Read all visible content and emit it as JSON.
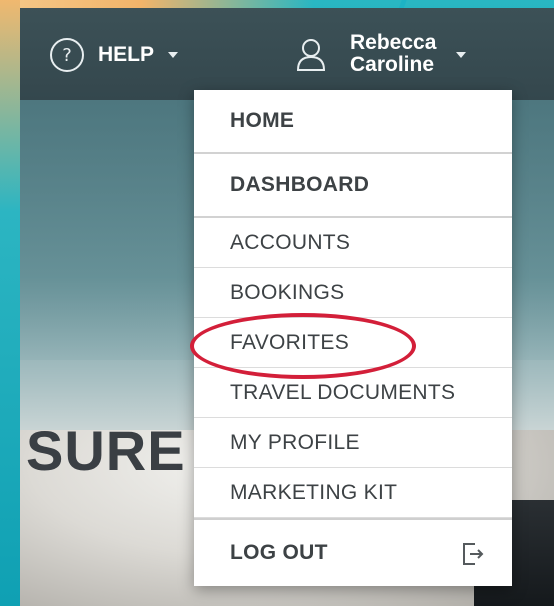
{
  "hero": {
    "text": "SURE"
  },
  "topnav": {
    "help_icon_glyph": "?",
    "help_label": "HELP",
    "user_first_name": "Rebecca",
    "user_last_name": "Caroline"
  },
  "menu": {
    "items": [
      {
        "label": "HOME",
        "bold": true
      },
      {
        "label": "DASHBOARD",
        "bold": true
      },
      {
        "label": "ACCOUNTS",
        "bold": false
      },
      {
        "label": "BOOKINGS",
        "bold": false
      },
      {
        "label": "FAVORITES",
        "bold": false,
        "highlighted": true
      },
      {
        "label": "TRAVEL DOCUMENTS",
        "bold": false
      },
      {
        "label": "MY PROFILE",
        "bold": false
      },
      {
        "label": "MARKETING KIT",
        "bold": false
      },
      {
        "label": "LOG OUT",
        "bold": true
      }
    ]
  },
  "icons": {
    "help": "question-circle-icon",
    "user": "user-outline-icon",
    "logout": "logout-icon",
    "caret": "caret-down-icon"
  },
  "colors": {
    "topbar": "#3c5157",
    "highlight_ring": "#d31f39",
    "menu_text": "#3d4245"
  }
}
